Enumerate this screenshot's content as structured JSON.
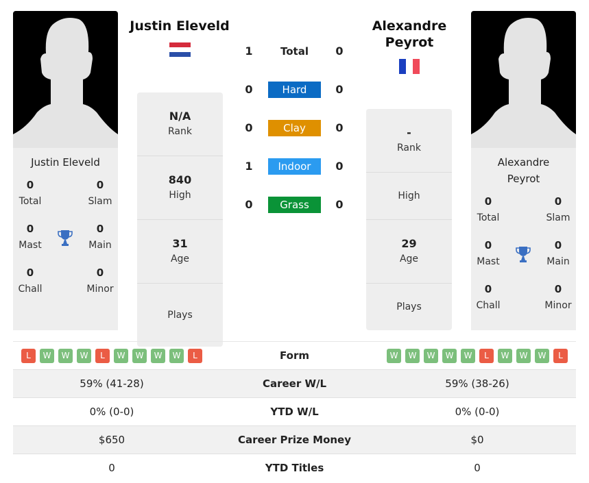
{
  "player1": {
    "name": "Justin Eleveld",
    "card_name": "Justin Eleveld",
    "country": "Netherlands",
    "flag_colors": [
      "#d52b3c",
      "#ffffff",
      "#2a4fa8"
    ],
    "titles": [
      {
        "label": "Total",
        "value": "0"
      },
      {
        "label": "Slam",
        "value": "0"
      },
      {
        "label": "Mast",
        "value": "0"
      },
      {
        "label": "Main",
        "value": "0"
      },
      {
        "label": "Chall",
        "value": "0"
      },
      {
        "label": "Minor",
        "value": "0"
      }
    ],
    "stats": [
      {
        "label": "Rank",
        "value": "N/A"
      },
      {
        "label": "High",
        "value": "840"
      },
      {
        "label": "Age",
        "value": "31"
      },
      {
        "label": "Plays",
        "value": ""
      }
    ]
  },
  "player2": {
    "name": "Alexandre Peyrot",
    "card_name": "Alexandre Peyrot",
    "country": "France",
    "flag_colors": [
      "#1a3fc0",
      "#ffffff",
      "#f04a5a"
    ],
    "titles": [
      {
        "label": "Total",
        "value": "0"
      },
      {
        "label": "Slam",
        "value": "0"
      },
      {
        "label": "Mast",
        "value": "0"
      },
      {
        "label": "Main",
        "value": "0"
      },
      {
        "label": "Chall",
        "value": "0"
      },
      {
        "label": "Minor",
        "value": "0"
      }
    ],
    "stats": [
      {
        "label": "Rank",
        "value": "-"
      },
      {
        "label": "High",
        "value": ""
      },
      {
        "label": "Age",
        "value": "29"
      },
      {
        "label": "Plays",
        "value": ""
      }
    ]
  },
  "h2h": [
    {
      "surface": "Total",
      "p1": "1",
      "p2": "0",
      "color": ""
    },
    {
      "surface": "Hard",
      "p1": "0",
      "p2": "0",
      "color": "#0b6bc4"
    },
    {
      "surface": "Clay",
      "p1": "0",
      "p2": "0",
      "color": "#df9000"
    },
    {
      "surface": "Indoor",
      "p1": "1",
      "p2": "0",
      "color": "#2b9bf0"
    },
    {
      "surface": "Grass",
      "p1": "0",
      "p2": "0",
      "color": "#0a9337"
    }
  ],
  "comparison": {
    "form_label": "Form",
    "p1_form": [
      "L",
      "W",
      "W",
      "W",
      "L",
      "W",
      "W",
      "W",
      "W",
      "L"
    ],
    "p2_form": [
      "W",
      "W",
      "W",
      "W",
      "W",
      "L",
      "W",
      "W",
      "W",
      "L"
    ],
    "rows": [
      {
        "label": "Career W/L",
        "p1": "59% (41-28)",
        "p2": "59% (38-26)"
      },
      {
        "label": "YTD W/L",
        "p1": "0% (0-0)",
        "p2": "0% (0-0)"
      },
      {
        "label": "Career Prize Money",
        "p1": "$650",
        "p2": "$0"
      },
      {
        "label": "YTD Titles",
        "p1": "0",
        "p2": "0"
      }
    ]
  },
  "colors": {
    "trophy": "#3a6fc2",
    "win": "#7cbf7c",
    "loss": "#eb5c45",
    "card_bg": "#eeeeee"
  }
}
